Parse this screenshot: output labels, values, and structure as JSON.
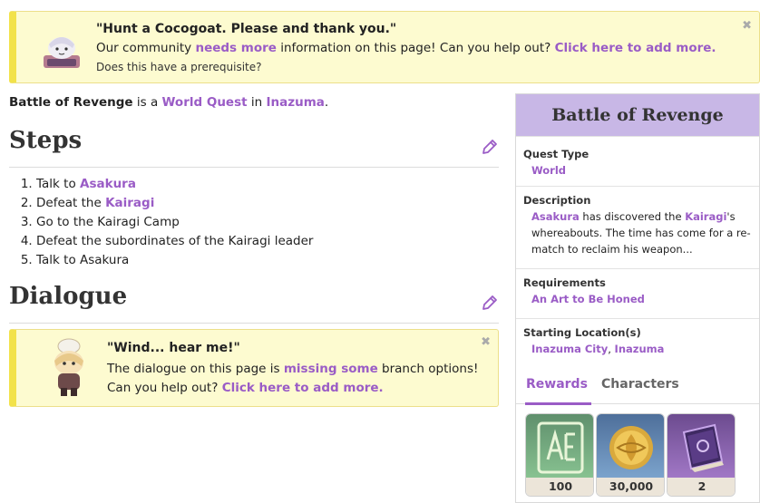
{
  "notice_top": {
    "title": "\"Hunt a Cocogoat. Please and thank you.\"",
    "body_prefix": "Our community ",
    "body_link1": "needs more",
    "body_mid": " information on this page! Can you help out? ",
    "body_link2": "Click here to add more.",
    "sub": "Does this have a prerequisite?"
  },
  "intro": {
    "quest_name": "Battle of Revenge",
    "is_a": " is a ",
    "type_link": "World Quest",
    "in": " in ",
    "region_link": "Inazuma",
    "period": "."
  },
  "sections": {
    "steps_title": "Steps",
    "dialogue_title": "Dialogue"
  },
  "steps": [
    {
      "prefix": "Talk to ",
      "link": "Asakura",
      "suffix": ""
    },
    {
      "prefix": "Defeat the ",
      "link": "Kairagi",
      "suffix": ""
    },
    {
      "prefix": "Go to the Kairagi Camp",
      "link": "",
      "suffix": ""
    },
    {
      "prefix": "Defeat the subordinates of the Kairagi leader",
      "link": "",
      "suffix": ""
    },
    {
      "prefix": "Talk to Asakura",
      "link": "",
      "suffix": ""
    }
  ],
  "notice_dialogue": {
    "title": "\"Wind... hear me!\"",
    "body_prefix": "The dialogue on this page is ",
    "body_link1": "missing some",
    "body_mid": " branch options! Can you help out? ",
    "body_link2": "Click here to add more."
  },
  "infobox": {
    "title": "Battle of Revenge",
    "quest_type_label": "Quest Type",
    "quest_type_value": "World",
    "description_label": "Description",
    "desc_link1": "Asakura",
    "desc_text1": " has discovered the ",
    "desc_link2": "Kairagi",
    "desc_text2": "'s whereabouts. The time has come for a re-match to reclaim his weapon...",
    "requirements_label": "Requirements",
    "requirements_value": "An Art to Be Honed",
    "starting_label": "Starting Location(s)",
    "starting_link1": "Inazuma City",
    "starting_sep": ", ",
    "starting_link2": "Inazuma",
    "tabs": [
      "Rewards",
      "Characters"
    ],
    "active_tab": "Rewards"
  },
  "rewards": [
    {
      "icon": "adventure-exp-icon",
      "count": "100"
    },
    {
      "icon": "mora-icon",
      "count": "30,000"
    },
    {
      "icon": "heros-wit-book-icon",
      "count": "2"
    }
  ],
  "colors": {
    "link": "#9a5cc6",
    "notice_bg": "#fdfbd0",
    "notice_border": "#f2e24a",
    "infobox_title_bg": "#c8b7e6"
  }
}
